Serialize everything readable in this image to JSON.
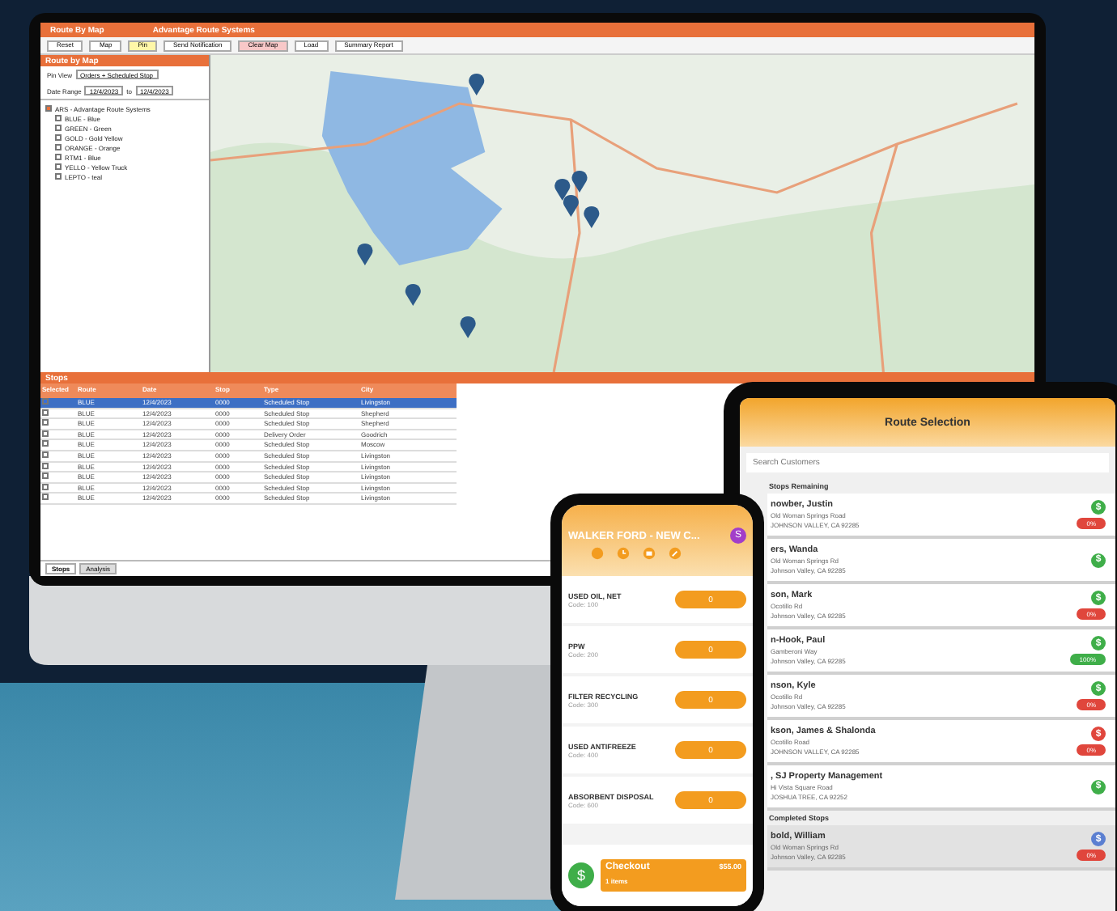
{
  "desktop": {
    "title": "Route By Map",
    "subtitle": "Advantage Route Systems",
    "toolbar": [
      "Reset",
      "Map",
      "Pin",
      "Send Notification",
      "Clear Map",
      "Load",
      "Summary Report"
    ],
    "panel": {
      "title": "Route by Map",
      "pin_view_label": "Pin View",
      "pin_view": "Orders + Scheduled Stop",
      "date_label": "Date Range",
      "date_from": "12/4/2023",
      "date_to_label": "to",
      "date_to": "12/4/2023",
      "tree": [
        {
          "label": "ARS - Advantage Route Systems",
          "expanded": true,
          "children": [
            {
              "label": "BLUE - Blue",
              "checked": false
            },
            {
              "label": "GREEN - Green",
              "checked": false
            },
            {
              "label": "GOLD - Gold Yellow",
              "checked": false
            },
            {
              "label": "ORANGE - Orange",
              "checked": false
            },
            {
              "label": "RTM1 - Blue",
              "checked": false
            },
            {
              "label": "YELLO - Yellow Truck",
              "checked": false
            },
            {
              "label": "LEPTO - teal",
              "checked": false
            }
          ]
        }
      ]
    },
    "table": {
      "title": "Stops",
      "columns": [
        "Selected",
        "Route",
        "Date",
        "Stop",
        "Type",
        "City"
      ],
      "rows": [
        {
          "selected": true,
          "cells": [
            "",
            "BLUE",
            "12/4/2023",
            "0000",
            "Scheduled Stop",
            "Livingston"
          ]
        },
        {
          "selected": false,
          "cells": [
            "",
            "BLUE",
            "12/4/2023",
            "0000",
            "Scheduled Stop",
            "Shepherd"
          ]
        },
        {
          "selected": false,
          "cells": [
            "",
            "BLUE",
            "12/4/2023",
            "0000",
            "Scheduled Stop",
            "Shepherd"
          ]
        },
        {
          "selected": false,
          "cells": [
            "",
            "BLUE",
            "12/4/2023",
            "0000",
            "Delivery Order",
            "Goodrich"
          ]
        },
        {
          "selected": false,
          "cells": [
            "",
            "BLUE",
            "12/4/2023",
            "0000",
            "Scheduled Stop",
            "Moscow"
          ]
        },
        {
          "selected": false,
          "cells": [
            "",
            "BLUE",
            "12/4/2023",
            "0000",
            "Scheduled Stop",
            "Livingston"
          ]
        },
        {
          "selected": false,
          "cells": [
            "",
            "BLUE",
            "12/4/2023",
            "0000",
            "Scheduled Stop",
            "Livingston"
          ]
        },
        {
          "selected": false,
          "cells": [
            "",
            "BLUE",
            "12/4/2023",
            "0000",
            "Scheduled Stop",
            "Livingston"
          ]
        },
        {
          "selected": false,
          "cells": [
            "",
            "BLUE",
            "12/4/2023",
            "0000",
            "Scheduled Stop",
            "Livingston"
          ]
        },
        {
          "selected": false,
          "cells": [
            "",
            "BLUE",
            "12/4/2023",
            "0000",
            "Scheduled Stop",
            "Livingston"
          ]
        }
      ]
    },
    "bottom_tabs": [
      {
        "label": "Stops",
        "selected": true
      },
      {
        "label": "Analysis",
        "selected": false
      }
    ]
  },
  "tablet": {
    "title": "Route Selection",
    "search": {
      "placeholder": "Search Customers"
    },
    "section_remaining": "Stops Remaining",
    "stops": [
      {
        "name": "nowber, Justin",
        "address": "Old Woman Springs Road",
        "city": "JOHNSON VALLEY, CA 92285",
        "badge": {
          "text": "$",
          "color": "#3fae49"
        },
        "percent": {
          "text": "0%",
          "color": "#e0463c"
        }
      },
      {
        "name": "ers, Wanda",
        "address": "Old Woman Springs Rd",
        "city": "Johnson Valley, CA 92285",
        "badge": {
          "text": "$",
          "color": "#3fae49"
        }
      },
      {
        "name": "son, Mark",
        "address": "Ocotillo Rd",
        "city": "Johnson Valley, CA 92285",
        "badge": {
          "text": "$",
          "color": "#3fae49"
        },
        "percent": {
          "text": "0%",
          "color": "#e0463c"
        }
      },
      {
        "name": "n-Hook, Paul",
        "address": "Gamberoni Way",
        "city": "Johnson Valley, CA 92285",
        "badge": {
          "text": "$",
          "color": "#3fae49"
        },
        "percent": {
          "text": "100%",
          "color": "#3fae49"
        }
      },
      {
        "name": "nson, Kyle",
        "address": "Ocotillo Rd",
        "city": "Johnson Valley, CA 92285",
        "badge": {
          "text": "$",
          "color": "#3fae49"
        },
        "percent": {
          "text": "0%",
          "color": "#e0463c"
        }
      },
      {
        "name": "kson, James & Shalonda",
        "address": "Ocotillo Road",
        "city": "JOHNSON VALLEY, CA 92285",
        "badge": {
          "text": "$",
          "color": "#e0463c"
        },
        "percent": {
          "text": "0%",
          "color": "#e0463c"
        }
      },
      {
        "name": ", SJ Property Management",
        "address": "Hi Vista Square Road",
        "city": "JOSHUA TREE, CA 92252",
        "badge": {
          "text": "$",
          "color": "#3fae49"
        }
      }
    ],
    "section_completed": "Completed Stops",
    "completed": [
      {
        "name": "bold, William",
        "address": "Old Woman Springs Rd",
        "city": "Johnson Valley, CA 92285",
        "badge": {
          "text": "$",
          "color": "#5b7fd1"
        },
        "percent": {
          "text": "0%",
          "color": "#e0463c"
        }
      }
    ]
  },
  "phone": {
    "title": "WALKER FORD - NEW C...",
    "avatar": "S",
    "items": [
      {
        "name": "USED OIL, NET",
        "code": "Code: 100",
        "quantity": "0"
      },
      {
        "name": "PPW",
        "code": "Code: 200",
        "quantity": "0"
      },
      {
        "name": "FILTER RECYCLING",
        "code": "Code: 300",
        "quantity": "0"
      },
      {
        "name": "USED ANTIFREEZE",
        "code": "Code: 400",
        "quantity": "0"
      },
      {
        "name": "ABSORBENT DISPOSAL",
        "code": "Code: 600",
        "quantity": "0"
      }
    ],
    "checkout": {
      "label": "Checkout",
      "count": "1 items",
      "total": "$55.00",
      "currency": "$"
    }
  }
}
